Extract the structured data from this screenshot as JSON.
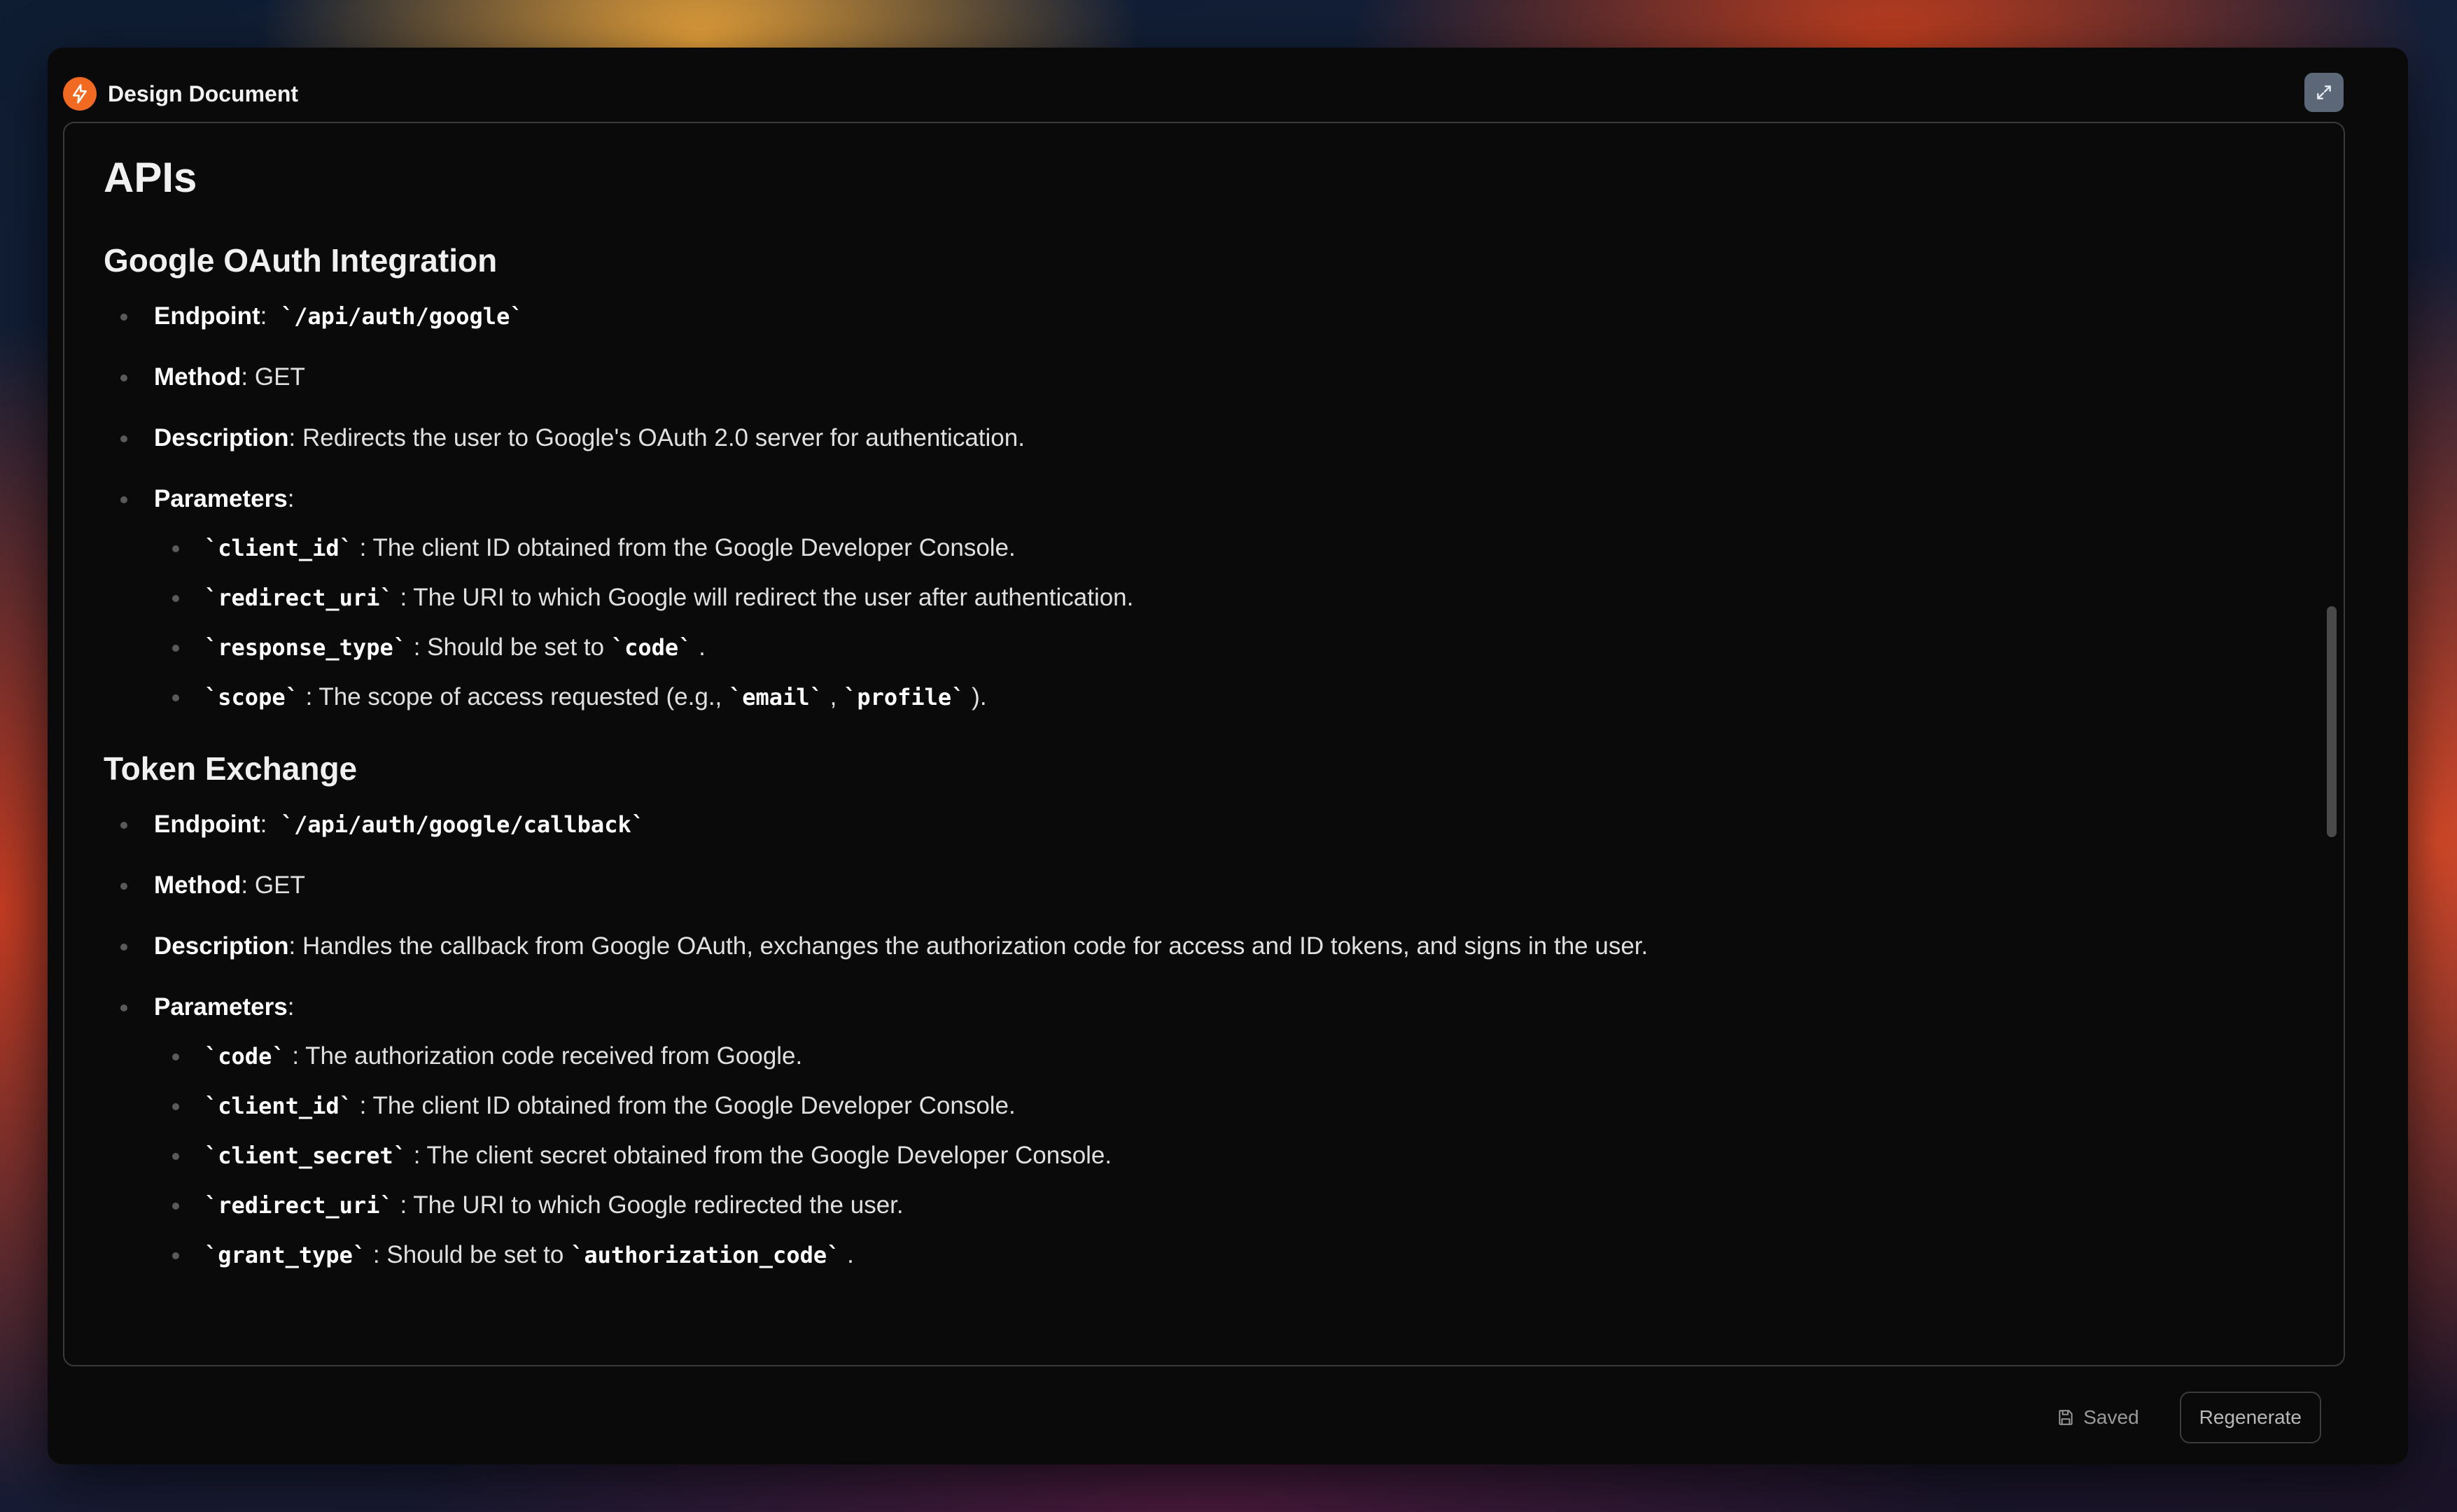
{
  "window": {
    "title": "Design Document"
  },
  "doc": {
    "h1": "APIs",
    "sections": [
      {
        "heading": "Google OAuth Integration",
        "endpoint_label": "Endpoint",
        "endpoint_value": "`/api/auth/google`",
        "method_label": "Method",
        "method_value": ": GET",
        "description_label": "Description",
        "description_value": ": Redirects the user to Google's OAuth 2.0 server for authentication.",
        "parameters_label": "Parameters",
        "params": [
          {
            "code": "`client_id`",
            "text": " : The client ID obtained from the Google Developer Console."
          },
          {
            "code": "`redirect_uri`",
            "text": " : The URI to which Google will redirect the user after authentication."
          },
          {
            "code": "`response_type`",
            "text": " : Should be set to ",
            "code2": "`code`",
            "text2": " ."
          },
          {
            "code": "`scope`",
            "text": " : The scope of access requested (e.g., ",
            "code2": "`email`",
            "text2": " , ",
            "code3": "`profile`",
            "text3": " )."
          }
        ]
      },
      {
        "heading": "Token Exchange",
        "endpoint_label": "Endpoint",
        "endpoint_value": "`/api/auth/google/callback`",
        "method_label": "Method",
        "method_value": ": GET",
        "description_label": "Description",
        "description_value": ": Handles the callback from Google OAuth, exchanges the authorization code for access and ID tokens, and signs in the user.",
        "parameters_label": "Parameters",
        "params": [
          {
            "code": "`code`",
            "text": " : The authorization code received from Google."
          },
          {
            "code": "`client_id`",
            "text": " : The client ID obtained from the Google Developer Console."
          },
          {
            "code": "`client_secret`",
            "text": " : The client secret obtained from the Google Developer Console."
          },
          {
            "code": "`redirect_uri`",
            "text": " : The URI to which Google redirected the user."
          },
          {
            "code": "`grant_type`",
            "text": " : Should be set to ",
            "code2": "`authorization_code`",
            "text2": " ."
          }
        ]
      }
    ]
  },
  "footer": {
    "saved_label": "Saved",
    "regenerate_label": "Regenerate"
  },
  "colors": {
    "accent": "#f26a21",
    "background": "#0a0a0a",
    "text": "#f0f0f0"
  },
  "icons": {
    "logo": "bolt-icon",
    "expand": "expand-icon",
    "saved": "save-icon"
  }
}
